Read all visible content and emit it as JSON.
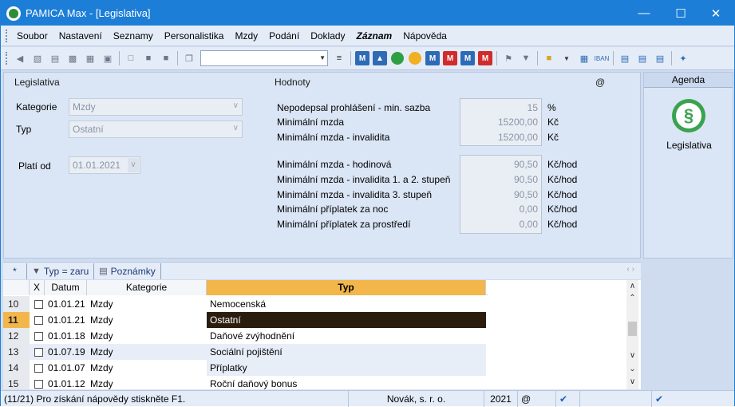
{
  "window": {
    "title": "PAMICA Max - [Legislativa]"
  },
  "menu": [
    "Soubor",
    "Nastavení",
    "Seznamy",
    "Personalistika",
    "Mzdy",
    "Podání",
    "Doklady",
    "Záznam",
    "Nápověda"
  ],
  "form": {
    "section_left": "Legislativa",
    "section_right": "Hodnoty",
    "at_sign": "@",
    "kategorie_label": "Kategorie",
    "kategorie_value": "Mzdy",
    "typ_label": "Typ",
    "typ_value": "Ostatní",
    "plati_od_label": "Platí od",
    "plati_od_value": "01.01.2021"
  },
  "values_group1": [
    {
      "label": "Nepodepsal prohlášení - min. sazba",
      "value": "15",
      "unit": "%"
    },
    {
      "label": "Minimální mzda",
      "value": "15200,00",
      "unit": "Kč"
    },
    {
      "label": "Minimální mzda - invalidita",
      "value": "15200,00",
      "unit": "Kč"
    }
  ],
  "values_group2": [
    {
      "label": "Minimální mzda - hodinová",
      "value": "90,50",
      "unit": "Kč/hod"
    },
    {
      "label": "Minimální mzda - invalidita 1. a 2. stupeň",
      "value": "90,50",
      "unit": "Kč/hod"
    },
    {
      "label": "Minimální mzda - invalidita 3. stupeň",
      "value": "90,50",
      "unit": "Kč/hod"
    },
    {
      "label": "Minimální příplatek za noc",
      "value": "0,00",
      "unit": "Kč/hod"
    },
    {
      "label": "Minimální příplatek za prostředí",
      "value": "0,00",
      "unit": "Kč/hod"
    }
  ],
  "agenda": {
    "header": "Agenda",
    "item_label": "Legislativa"
  },
  "tabs": {
    "star": "*",
    "filter": "Typ = zaru",
    "notes": "Poznámky"
  },
  "grid": {
    "headers": {
      "x": "X",
      "datum": "Datum",
      "kategorie": "Kategorie",
      "typ": "Typ"
    },
    "rows": [
      {
        "num": "10",
        "datum": "01.01.21",
        "kategorie": "Mzdy",
        "typ": "Nemocenská"
      },
      {
        "num": "11",
        "datum": "01.01.21",
        "kategorie": "Mzdy",
        "typ": "Ostatní"
      },
      {
        "num": "12",
        "datum": "01.01.18",
        "kategorie": "Mzdy",
        "typ": "Daňové zvýhodnění"
      },
      {
        "num": "13",
        "datum": "01.07.19",
        "kategorie": "Mzdy",
        "typ": "Sociální pojištění"
      },
      {
        "num": "14",
        "datum": "01.01.07",
        "kategorie": "Mzdy",
        "typ": "Příplatky"
      },
      {
        "num": "15",
        "datum": "01.01.12",
        "kategorie": "Mzdy",
        "typ": "Roční daňový bonus"
      }
    ]
  },
  "status": {
    "help": "(11/21) Pro získání nápovědy stiskněte F1.",
    "company": "Novák, s. r. o.",
    "year": "2021",
    "at": "@"
  }
}
